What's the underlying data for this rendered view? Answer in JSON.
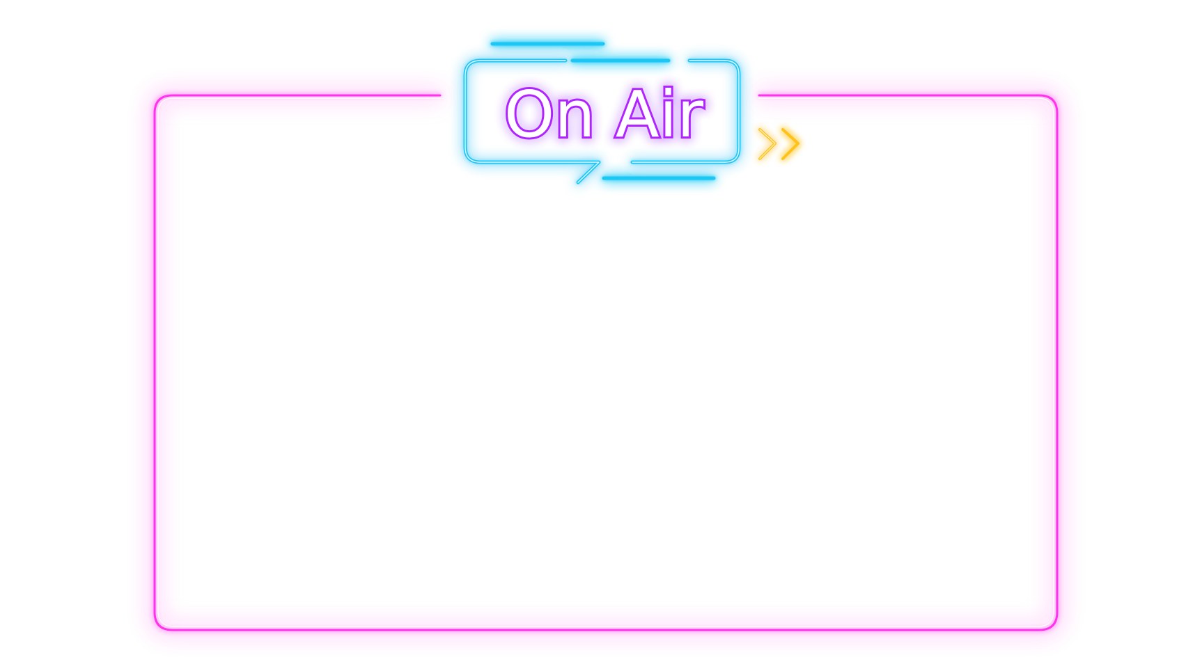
{
  "sign": {
    "title": "On Air",
    "arrow_icon": "double-chevron-right-icon"
  },
  "colors": {
    "frame": "#ff33ee",
    "frame_glow": "#ff6ff2",
    "badge": "#1fc7f5",
    "title_stroke": "#b022ff",
    "title_fill": "#ffffff",
    "arrow": "#ffc21a",
    "background": "#ffffff"
  }
}
